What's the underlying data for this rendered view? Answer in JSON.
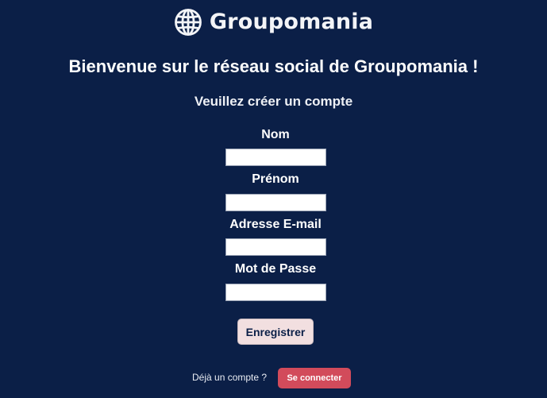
{
  "brand": {
    "name": "Groupomania",
    "logo_icon": "globe-icon"
  },
  "header": {
    "welcome": "Bienvenue sur le réseau social de Groupomania !",
    "subtitle": "Veuillez créer un compte"
  },
  "form": {
    "fields": [
      {
        "label": "Nom",
        "value": ""
      },
      {
        "label": "Prénom",
        "value": ""
      },
      {
        "label": "Adresse E-mail",
        "value": ""
      },
      {
        "label": "Mot de Passe",
        "value": ""
      }
    ],
    "submit_label": "Enregistrer"
  },
  "footer": {
    "already_text": "Déjà un compte ?",
    "login_label": "Se connecter"
  },
  "colors": {
    "background": "#0b1f47",
    "submit_bg": "#f2dfe0",
    "login_bg": "#d24b5b"
  }
}
